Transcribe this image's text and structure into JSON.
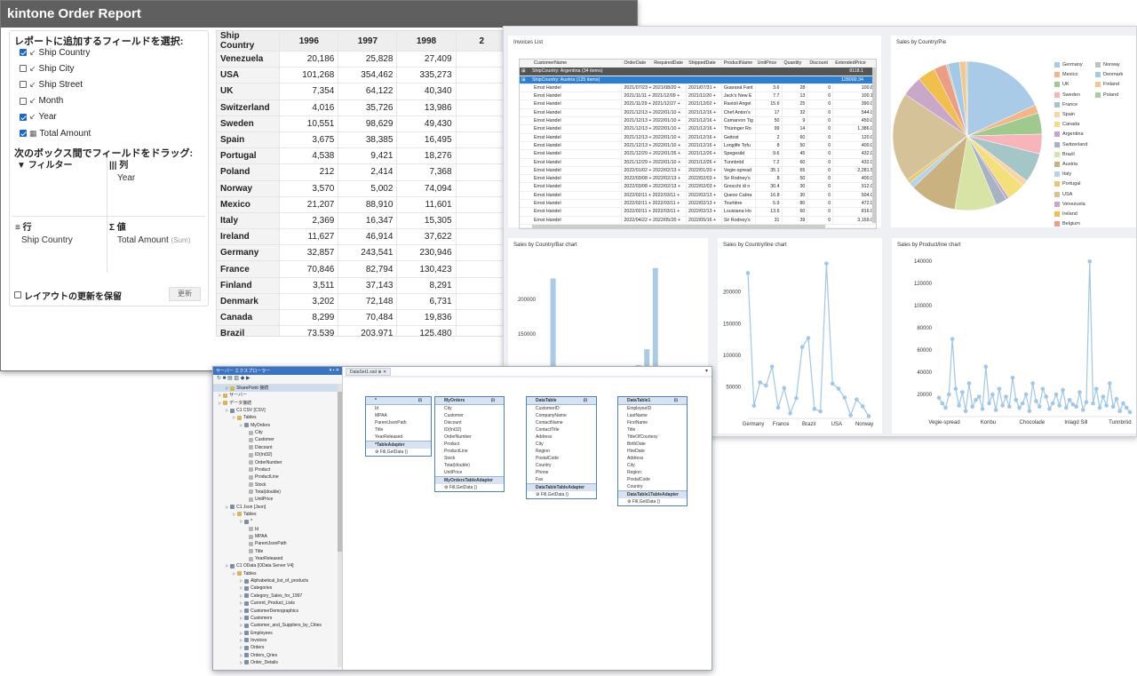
{
  "kintone": {
    "title": "kintone Order Report",
    "select_heading": "レポートに追加するフィールドを選択:",
    "fields": [
      {
        "label": "Ship Country",
        "checked": true,
        "icon": "date-icon"
      },
      {
        "label": "Ship City",
        "checked": false,
        "icon": "date-icon"
      },
      {
        "label": "Ship Street",
        "checked": false,
        "icon": "date-icon"
      },
      {
        "label": "Month",
        "checked": false,
        "icon": "date-icon"
      },
      {
        "label": "Year",
        "checked": true,
        "icon": "date-icon"
      },
      {
        "label": "Total Amount",
        "checked": true,
        "icon": "calculator-icon"
      }
    ],
    "drag_heading": "次のボックス間でフィールドをドラッグ:",
    "zones": {
      "filter_label": "フィルター",
      "columns_label": "列",
      "columns_value": "Year",
      "rows_label": "行",
      "rows_value": "Ship Country",
      "values_label": "値",
      "values_value": "Total Amount",
      "values_agg": "(Sum)"
    },
    "defer_label": "レイアウトの更新を保留",
    "update_button": "更新",
    "pivot": {
      "corner": "Ship Country",
      "columns": [
        "1996",
        "1997",
        "1998",
        "2"
      ],
      "rows": [
        {
          "name": "Venezuela",
          "values": [
            "20,186",
            "25,828",
            "27,409"
          ]
        },
        {
          "name": "USA",
          "values": [
            "101,268",
            "354,462",
            "335,273"
          ]
        },
        {
          "name": "UK",
          "values": [
            "7,354",
            "64,122",
            "40,340"
          ]
        },
        {
          "name": "Switzerland",
          "values": [
            "4,016",
            "35,726",
            "13,986"
          ]
        },
        {
          "name": "Sweden",
          "values": [
            "10,551",
            "98,629",
            "49,430"
          ]
        },
        {
          "name": "Spain",
          "values": [
            "3,675",
            "38,385",
            "16,495"
          ]
        },
        {
          "name": "Portugal",
          "values": [
            "4,538",
            "9,421",
            "18,276"
          ]
        },
        {
          "name": "Poland",
          "values": [
            "212",
            "2,414",
            "7,368"
          ]
        },
        {
          "name": "Norway",
          "values": [
            "3,570",
            "5,002",
            "74,094"
          ]
        },
        {
          "name": "Mexico",
          "values": [
            "21,207",
            "88,910",
            "11,601"
          ]
        },
        {
          "name": "Italy",
          "values": [
            "2,369",
            "16,347",
            "15,305"
          ]
        },
        {
          "name": "Ireland",
          "values": [
            "11,627",
            "46,914",
            "37,622"
          ]
        },
        {
          "name": "Germany",
          "values": [
            "32,857",
            "243,541",
            "230,946"
          ]
        },
        {
          "name": "France",
          "values": [
            "70,846",
            "82,794",
            "130,423"
          ]
        },
        {
          "name": "Finland",
          "values": [
            "3,511",
            "37,143",
            "8,291"
          ]
        },
        {
          "name": "Denmark",
          "values": [
            "3,202",
            "72,148",
            "6,731"
          ]
        },
        {
          "name": "Canada",
          "values": [
            "8,299",
            "70,484",
            "19,836"
          ]
        },
        {
          "name": "Brazil",
          "values": [
            "73,539",
            "203,971",
            "125,480"
          ]
        }
      ]
    }
  },
  "dashboard": {
    "invoices": {
      "title": "Invoices List",
      "columns": [
        "CustomerName",
        "OrderDate",
        "RequiredDate",
        "ShippedDate",
        "ProductName",
        "UnitPrice",
        "Quantity",
        "Discount",
        "ExtendedPrice"
      ],
      "groups": [
        {
          "label": "ShipCountry: Argentina (34 items)",
          "total": "8118.1"
        },
        {
          "label": "ShipCountry: Austria (125 items)",
          "total": "128000.34"
        }
      ],
      "rows": [
        [
          "Ernst Handel",
          "2021/07/23 + 2021/08/20 +",
          "2021/07/31 +",
          "Guaraná Fant",
          "3.6",
          "28",
          "0",
          "100.8"
        ],
        [
          "Ernst Handel",
          "2021/11/11 + 2021/12/09 +",
          "2021/11/20 +",
          "Jack's New E",
          "7.7",
          "13",
          "0",
          "100.1"
        ],
        [
          "Ernst Handel",
          "2021/11/29 + 2021/12/27 +",
          "2021/12/02 +",
          "Ravioli Angel",
          "15.6",
          "25",
          "0",
          "390.0"
        ],
        [
          "Ernst Handel",
          "2021/12/13 + 2022/01/10 +",
          "2021/12/16 +",
          "Chef Anton's",
          "17",
          "32",
          "0",
          "544.0"
        ],
        [
          "Ernst Handel",
          "2021/12/13 + 2022/01/10 +",
          "2021/12/16 +",
          "Camarvon Tig",
          "50",
          "9",
          "0",
          "450.0"
        ],
        [
          "Ernst Handel",
          "2021/12/13 + 2022/01/10 +",
          "2021/12/16 +",
          "Thüringer Ro",
          "99",
          "14",
          "0",
          "1,386.0"
        ],
        [
          "Ernst Handel",
          "2021/12/13 + 2022/01/10 +",
          "2021/12/16 +",
          "Geitost",
          "2",
          "60",
          "0",
          "120.0"
        ],
        [
          "Ernst Handel",
          "2021/12/13 + 2022/01/10 +",
          "2021/12/16 +",
          "Longlife Tofu",
          "8",
          "50",
          "0",
          "400.0"
        ],
        [
          "Ernst Handel",
          "2021/12/29 + 2022/01/26 +",
          "2021/12/26 +",
          "Spegesild",
          "9.6",
          "45",
          "0",
          "432.0"
        ],
        [
          "Ernst Handel",
          "2021/12/29 + 2022/01/10 +",
          "2021/12/26 +",
          "Tunnbröd",
          "7.2",
          "60",
          "0",
          "432.0"
        ],
        [
          "Ernst Handel",
          "2022/01/02 + 2022/02/13 +",
          "2022/01/20 +",
          "Vegie-spread",
          "35.1",
          "65",
          "0",
          "2,281.5"
        ],
        [
          "Ernst Handel",
          "2022/03/08 + 2022/02/13 +",
          "2022/02/03 +",
          "Sir Rodney's",
          "8",
          "50",
          "0",
          "400.0"
        ],
        [
          "Ernst Handel",
          "2022/03/08 + 2022/02/13 +",
          "2022/02/03 +",
          "Gnocchi di n",
          "30.4",
          "30",
          "0",
          "912.0"
        ],
        [
          "Ernst Handel",
          "2022/02/11 + 2022/03/11 +",
          "2022/02/13 +",
          "Queso Cabra",
          "16.8",
          "30",
          "0",
          "504.0"
        ],
        [
          "Ernst Handel",
          "2022/02/11 + 2022/03/11 +",
          "2022/02/13 +",
          "Tourtière",
          "5.9",
          "80",
          "0",
          "472.0"
        ],
        [
          "Ernst Handel",
          "2022/02/11 + 2022/03/11 +",
          "2022/02/13 +",
          "Louisiana Ho",
          "13.6",
          "60",
          "0",
          "816.0"
        ],
        [
          "Ernst Handel",
          "2022/04/22 + 2022/05/20 +",
          "2022/05/16 +",
          "Sir Rodney's",
          "31",
          "39",
          "0",
          "3,159.0"
        ]
      ]
    },
    "pie": {
      "title": "Sales by Country/Pie",
      "chart_data": {
        "type": "pie",
        "labels": [
          "Germany",
          "Mexico",
          "UK",
          "Sweden",
          "France",
          "Spain",
          "Canada",
          "Argentina",
          "Switzerland",
          "Brazil",
          "Austria",
          "Italy",
          "Portugal",
          "USA",
          "Venezuela",
          "Ireland",
          "Belgium",
          "Norway",
          "Denmark",
          "Finland",
          "Poland"
        ],
        "values": [
          230000,
          23000,
          58000,
          54000,
          81000,
          17000,
          50000,
          8000,
          31000,
          114000,
          128000,
          16000,
          11000,
          245000,
          56000,
          49000,
          34000,
          5000,
          32000,
          18000,
          3500
        ]
      },
      "colors": [
        "#a9cbe8",
        "#f4b688",
        "#9fc98e",
        "#f7b4b9",
        "#a5c6c6",
        "#f9d5a6",
        "#f4e07a",
        "#c2a6d1",
        "#a7b3c2",
        "#d8e4a6",
        "#c9b27f",
        "#b3d4ef",
        "#e9c86e",
        "#d6c298",
        "#c9a7c9",
        "#f1c04c",
        "#ed9d84",
        "#bec1c6",
        "#a2c9e6",
        "#f5c790",
        "#a7d0a0"
      ]
    },
    "bar": {
      "title": "Sales by Country/Bar chart",
      "chart_data": {
        "type": "bar",
        "y_ticks": [
          "200000",
          "150000",
          "100000"
        ],
        "ylim": [
          0,
          260000
        ],
        "values": [
          60000,
          230000,
          20000,
          55000,
          40000,
          30000,
          20000,
          5000,
          15000,
          85000,
          25000,
          105000,
          128000,
          245000
        ]
      }
    },
    "line_country": {
      "title": "Sales by Country/line chart",
      "chart_data": {
        "type": "line",
        "x_ticks": [
          "Germany",
          "France",
          "Brazil",
          "USA",
          "Norway"
        ],
        "y_ticks": [
          "200000",
          "150000",
          "100000",
          "50000"
        ],
        "ylim": [
          0,
          260000
        ],
        "values": [
          230000,
          20000,
          57000,
          52000,
          82000,
          17000,
          48000,
          8000,
          32000,
          113000,
          127000,
          15000,
          11000,
          245000,
          55000,
          47000,
          33000,
          5000,
          30000,
          19000,
          3500
        ]
      }
    },
    "line_product": {
      "title": "Sales by Product/line chart",
      "chart_data": {
        "type": "line",
        "x_ticks": [
          "Vegie-spread",
          "Konbu",
          "Chocolade",
          "Inlagd Sill",
          "Tunnbröd"
        ],
        "y_ticks": [
          "140000",
          "120000",
          "100000",
          "80000",
          "60000",
          "40000",
          "20000"
        ],
        "ylim": [
          0,
          145000
        ],
        "values": [
          17000,
          12000,
          8000,
          20000,
          70000,
          25000,
          10000,
          22000,
          5000,
          30000,
          9000,
          15000,
          18000,
          7000,
          45000,
          12000,
          20000,
          6000,
          25000,
          10000,
          18000,
          9000,
          35000,
          15000,
          8000,
          12000,
          20000,
          5000,
          30000,
          14000,
          9000,
          25000,
          18000,
          7000,
          12000,
          20000,
          10000,
          24000,
          8000,
          15000,
          11000,
          9000,
          22000,
          6000,
          13000,
          140000,
          12000,
          25000,
          8000,
          18000,
          10000,
          30000,
          9000,
          16000,
          5000,
          12000,
          8000,
          4000
        ]
      }
    }
  },
  "designer": {
    "explorer_title": "サーバー エクスプローラー",
    "explorer_buttons": "▾ ▪ ✕",
    "doc_tab": "DataSet1.xsd",
    "tree": [
      {
        "label": "SharePoint 接続",
        "depth": 0,
        "icon": "folder",
        "sel": true
      },
      {
        "label": "サーバー",
        "depth": 0,
        "icon": "folder"
      },
      {
        "label": "データ接続",
        "depth": 0,
        "icon": "folder"
      },
      {
        "label": "C1 CSV [CSV]",
        "depth": 1,
        "icon": "tbl"
      },
      {
        "label": "Tables",
        "depth": 2,
        "icon": "folder"
      },
      {
        "label": "MyOrders",
        "depth": 3,
        "icon": "tbl"
      },
      {
        "label": "City",
        "depth": 4,
        "icon": "col"
      },
      {
        "label": "Customer",
        "depth": 4,
        "icon": "col"
      },
      {
        "label": "Discount",
        "depth": 4,
        "icon": "col"
      },
      {
        "label": "ID(Int32)",
        "depth": 4,
        "icon": "col"
      },
      {
        "label": "OrderNumber",
        "depth": 4,
        "icon": "col"
      },
      {
        "label": "Product",
        "depth": 4,
        "icon": "col"
      },
      {
        "label": "ProductLine",
        "depth": 4,
        "icon": "col"
      },
      {
        "label": "Stock",
        "depth": 4,
        "icon": "col"
      },
      {
        "label": "Total(double)",
        "depth": 4,
        "icon": "col"
      },
      {
        "label": "UnitPrice",
        "depth": 4,
        "icon": "col"
      },
      {
        "label": "C1 Json [Json]",
        "depth": 1,
        "icon": "tbl"
      },
      {
        "label": "Tables",
        "depth": 2,
        "icon": "folder"
      },
      {
        "label": "*",
        "depth": 3,
        "icon": "tbl"
      },
      {
        "label": "Id",
        "depth": 4,
        "icon": "col"
      },
      {
        "label": "MPAA",
        "depth": 4,
        "icon": "col"
      },
      {
        "label": "ParentJsonPath",
        "depth": 4,
        "icon": "col"
      },
      {
        "label": "Title",
        "depth": 4,
        "icon": "col"
      },
      {
        "label": "YearReleased",
        "depth": 4,
        "icon": "col"
      },
      {
        "label": "C1 OData [OData Server V4]",
        "depth": 1,
        "icon": "tbl"
      },
      {
        "label": "Tables",
        "depth": 2,
        "icon": "folder"
      },
      {
        "label": "Alphabetical_list_of_products",
        "depth": 3,
        "icon": "tbl"
      },
      {
        "label": "Categories",
        "depth": 3,
        "icon": "tbl"
      },
      {
        "label": "Category_Sales_for_1997",
        "depth": 3,
        "icon": "tbl"
      },
      {
        "label": "Current_Product_Lists",
        "depth": 3,
        "icon": "tbl"
      },
      {
        "label": "CustomerDemographics",
        "depth": 3,
        "icon": "tbl"
      },
      {
        "label": "Customers",
        "depth": 3,
        "icon": "tbl"
      },
      {
        "label": "Customer_and_Suppliers_by_Cities",
        "depth": 3,
        "icon": "tbl"
      },
      {
        "label": "Employees",
        "depth": 3,
        "icon": "tbl"
      },
      {
        "label": "Invoices",
        "depth": 3,
        "icon": "tbl"
      },
      {
        "label": "Orders",
        "depth": 3,
        "icon": "tbl"
      },
      {
        "label": "Orders_Qries",
        "depth": 3,
        "icon": "tbl"
      },
      {
        "label": "Order_Details",
        "depth": 3,
        "icon": "tbl"
      }
    ],
    "tables": [
      {
        "name": "*",
        "columns": [
          "Id",
          "MPAA",
          "ParentJsonPath",
          "Title",
          "YearReleased"
        ],
        "adapter": "*TableAdapter",
        "query": "Fill,GetData ()"
      },
      {
        "name": "MyOrders",
        "columns": [
          "City",
          "Customer",
          "Discount",
          "ID(Int32)",
          "OrderNumber",
          "Product",
          "ProductLine",
          "Stock",
          "Total(double)",
          "UnitPrice"
        ],
        "adapter": "MyOrdersTableAdapter",
        "query": "Fill,GetData ()"
      },
      {
        "name": "DataTable",
        "columns": [
          "CustomerID",
          "CompanyName",
          "ContactName",
          "ContactTitle",
          "Address",
          "City",
          "Region",
          "PostalCode",
          "Country",
          "Phone",
          "Fax"
        ],
        "adapter": "DataTableTableAdapter",
        "query": "Fill,GetData ()"
      },
      {
        "name": "DataTable1",
        "columns": [
          "EmployeeID",
          "LastName",
          "FirstName",
          "Title",
          "TitleOfCourtesy",
          "BirthDate",
          "HireDate",
          "Address",
          "City",
          "Region",
          "PostalCode",
          "Country"
        ],
        "adapter": "DataTable1TableAdapter",
        "query": "Fill,GetData ()"
      }
    ]
  }
}
